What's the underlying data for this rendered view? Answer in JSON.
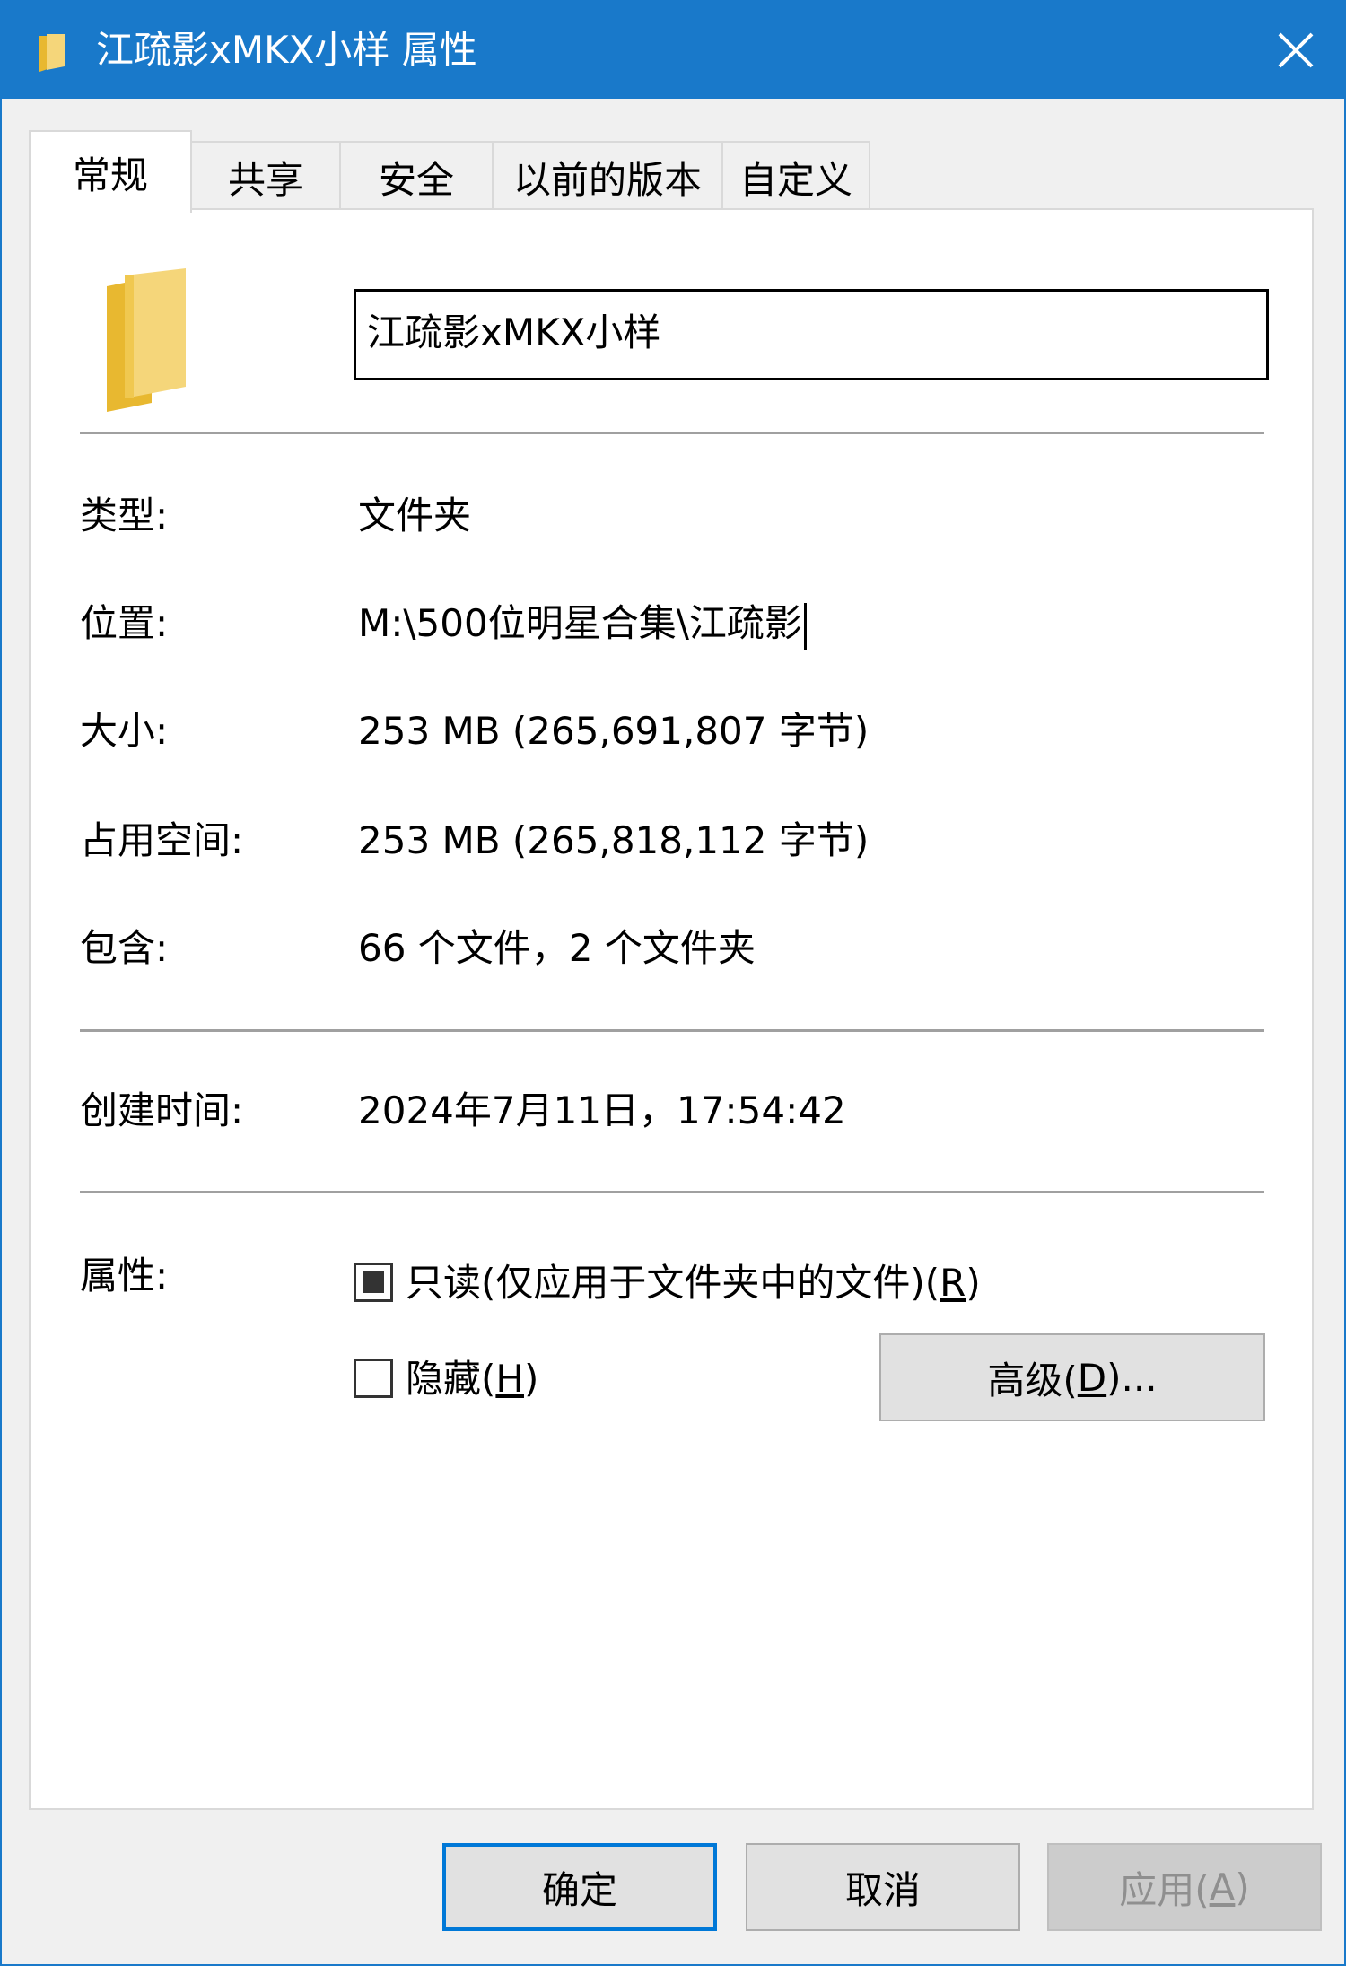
{
  "window": {
    "title": "江疏影xMKX小样 属性",
    "close_icon": "close-icon",
    "title_icon": "folder-icon"
  },
  "tabs": [
    {
      "label": "常规",
      "active": true
    },
    {
      "label": "共享",
      "active": false
    },
    {
      "label": "安全",
      "active": false
    },
    {
      "label": "以前的版本",
      "active": false
    },
    {
      "label": "自定义",
      "active": false
    }
  ],
  "general": {
    "folder_name": "江疏影xMKX小样",
    "type_label": "类型:",
    "type_value": "文件夹",
    "location_label": "位置:",
    "location_value": "M:\\500位明星合集\\江疏影",
    "size_label": "大小:",
    "size_value": "253 MB (265,691,807 字节)",
    "disk_size_label": "占用空间:",
    "disk_size_value": "253 MB (265,818,112 字节)",
    "contains_label": "包含:",
    "contains_value": "66 个文件，2 个文件夹",
    "created_label": "创建时间:",
    "created_value": "2024年7月11日，17:54:42",
    "attributes_label": "属性:",
    "readonly_text": "只读(仅应用于文件夹中的文件)(",
    "readonly_key": "R",
    "readonly_end": ")",
    "readonly_state": "indeterminate",
    "hidden_text": "隐藏(",
    "hidden_key": "H",
    "hidden_end": ")",
    "hidden_checked": false,
    "advanced_text": "高级(",
    "advanced_key": "D",
    "advanced_end": ")..."
  },
  "footer": {
    "ok": "确定",
    "cancel": "取消",
    "apply_text": "应用(",
    "apply_key": "A",
    "apply_end": ")"
  },
  "colors": {
    "titlebar": "#1979ca",
    "folder": "#f5d67a",
    "focus_border": "#0078d7"
  }
}
